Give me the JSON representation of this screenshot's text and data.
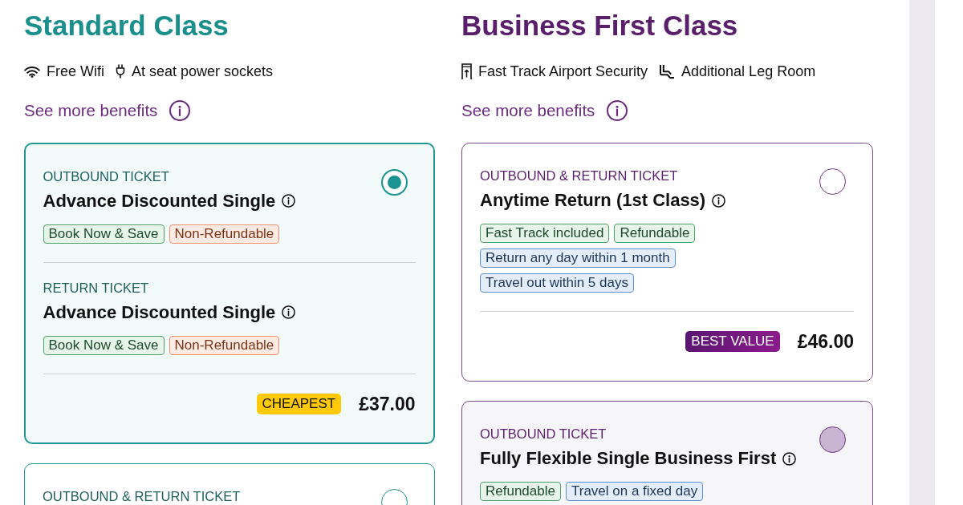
{
  "columns": [
    {
      "kind": "standard",
      "title": "Standard Class",
      "benefits": [
        {
          "kind": "wifi",
          "label": "Free Wifi"
        },
        {
          "kind": "power",
          "label": "At seat power sockets"
        }
      ],
      "more_link": "See more benefits",
      "fares": [
        {
          "selected": true,
          "hovered": false,
          "legs": [
            {
              "label": "OUTBOUND TICKET",
              "name": "Advance Discounted Single",
              "tags": [
                {
                  "kind": "positive",
                  "text": "Book Now & Save"
                },
                {
                  "kind": "warning",
                  "text": "Non-Refundable"
                }
              ]
            },
            {
              "label": "RETURN TICKET",
              "name": "Advance Discounted Single",
              "tags": [
                {
                  "kind": "positive",
                  "text": "Book Now & Save"
                },
                {
                  "kind": "warning",
                  "text": "Non-Refundable"
                }
              ]
            }
          ],
          "badge": {
            "kind": "cheapest",
            "text": "CHEAPEST"
          },
          "price": "£37.00"
        },
        {
          "selected": false,
          "hovered": false,
          "legs": [
            {
              "label": "OUTBOUND & RETURN TICKET"
            }
          ]
        }
      ]
    },
    {
      "kind": "first",
      "title": "Business First Class",
      "benefits": [
        {
          "kind": "security",
          "label": "Fast Track Airport Security"
        },
        {
          "kind": "legroom",
          "label": "Additional Leg Room"
        }
      ],
      "more_link": "See more benefits",
      "fares": [
        {
          "selected": false,
          "hovered": false,
          "legs": [
            {
              "label": "OUTBOUND & RETURN TICKET",
              "name": "Anytime Return (1st Class)",
              "tags": [
                {
                  "kind": "positive",
                  "text": "Fast Track included"
                },
                {
                  "kind": "positive",
                  "text": "Refundable"
                },
                {
                  "kind": "info",
                  "text": "Return any day within 1 month"
                },
                {
                  "kind": "info",
                  "text": "Travel out within 5 days"
                }
              ]
            }
          ],
          "badge": {
            "kind": "best_value",
            "text": "BEST VALUE"
          },
          "price": "£46.00"
        },
        {
          "selected": false,
          "hovered": true,
          "legs": [
            {
              "label": "OUTBOUND TICKET",
              "name": "Fully Flexible Single Business First",
              "tags": [
                {
                  "kind": "positive",
                  "text": "Refundable"
                },
                {
                  "kind": "info",
                  "text": "Travel on a fixed day"
                }
              ]
            }
          ]
        }
      ]
    }
  ]
}
